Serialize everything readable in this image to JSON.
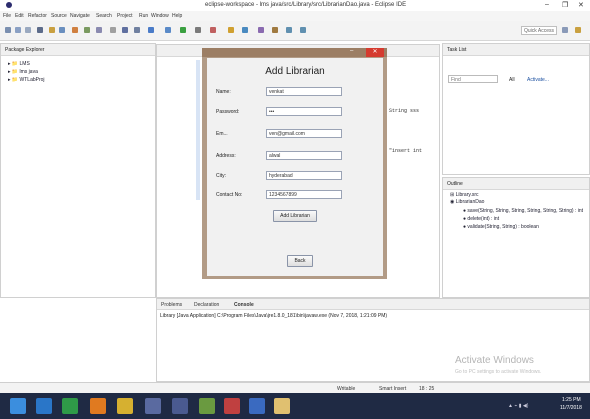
{
  "window": {
    "title": "eclipse-workspace - lms java/src/Library/src/LibrarianDao.java - Eclipse IDE",
    "min": "–",
    "max": "❐",
    "close": "✕"
  },
  "menu": [
    "File",
    "Edit",
    "Refactor",
    "Source",
    "Navigate",
    "Search",
    "Project",
    "Run",
    "Window",
    "Help"
  ],
  "toolbar": {
    "quick_access": "Quick Access"
  },
  "package_explorer": {
    "title": "Package Explorer",
    "items": [
      "LMS",
      "lms java",
      "WTLabProj"
    ]
  },
  "task_list": {
    "title": "Task List",
    "find_placeholder": "Find",
    "all_label": "All",
    "activate_label": "Activate..."
  },
  "outline": {
    "title": "Outline",
    "items": [
      "Library.src",
      "LibrarianDao",
      "save(String, String, String, String, String, String) : int",
      "delete(int) : int",
      "validate(String, String) : boolean"
    ]
  },
  "editor": {
    "code_lines": [
      "String sss",
      "\"insert int"
    ]
  },
  "dialog": {
    "heading": "Add Librarian",
    "fields": [
      {
        "label": "Name:",
        "value": "venkat"
      },
      {
        "label": "Password:",
        "value": "•••"
      },
      {
        "label": "Em...",
        "value": "ven@gmail.com"
      },
      {
        "label": "Address:",
        "value": "alwal"
      },
      {
        "label": "City:",
        "value": "hyderabad"
      },
      {
        "label": "Contact No:",
        "value": "1234567899"
      }
    ],
    "add_button": "Add Librarian",
    "back_button": "Back"
  },
  "console": {
    "tabs": [
      "Problems",
      "Declaration",
      "Console"
    ],
    "path": "Library [Java Application] C:\\Program Files\\Java\\jre1.8.0_181\\bin\\javaw.exe (Nov 7, 2018, 1:21:09 PM)"
  },
  "status": {
    "writable": "Writable",
    "insert_mode": "Smart Insert",
    "position": "18 : 25"
  },
  "watermark": {
    "line1": "Activate Windows",
    "line2": "Go to PC settings to activate Windows."
  },
  "taskbar": {
    "time": "1:25 PM",
    "date": "11/7/2018"
  },
  "colors": {
    "dialog_frame": "#b29b86",
    "close_red": "#d53b2f",
    "taskbar": "#1f2a44"
  }
}
